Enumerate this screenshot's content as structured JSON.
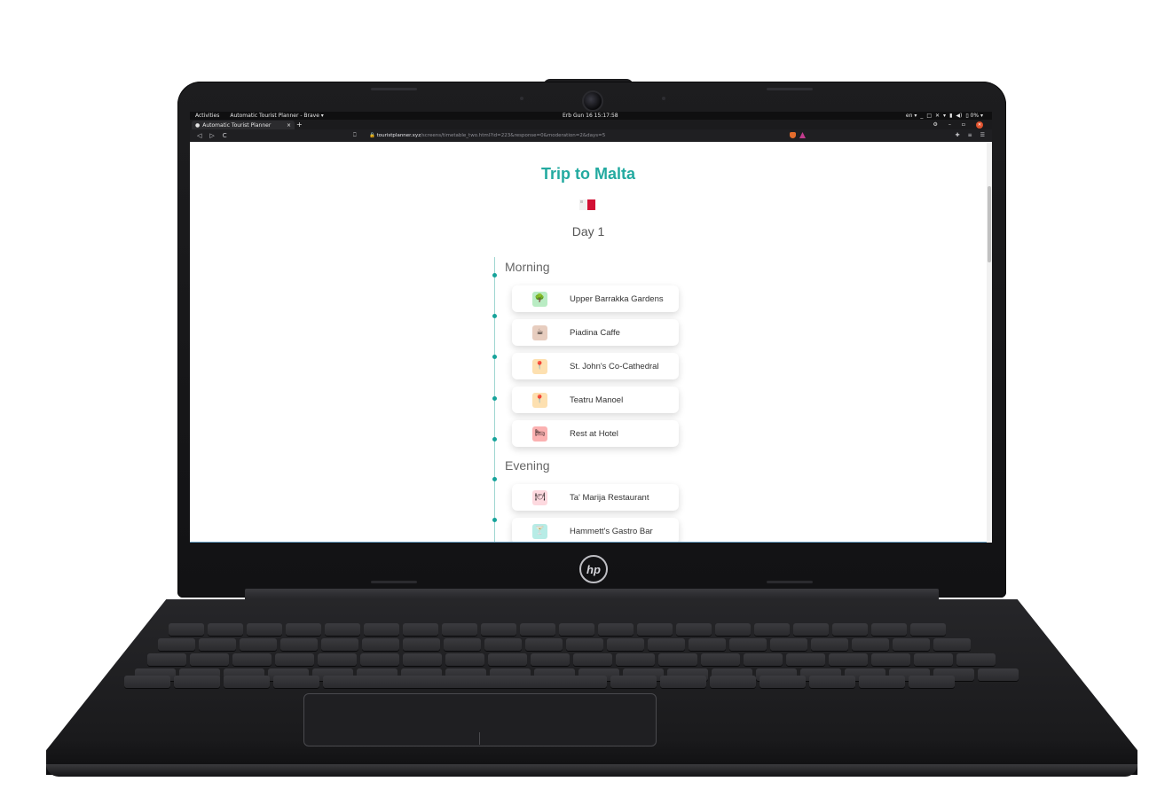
{
  "system_bar": {
    "activities": "Activities",
    "app_menu": "Automatic Tourist Planner - Brave ▾",
    "clock": "Erb Gun 16  15:17:58",
    "indicators": [
      "en ▾",
      "_",
      "□",
      "✕",
      "▾",
      "▮",
      "◀)",
      "▯ 0% ▾"
    ]
  },
  "browser": {
    "tab_title": "Automatic Tourist Planner",
    "tab_close": "×",
    "new_tab": "+",
    "window_min": "–",
    "window_max": "▫",
    "window_close": "✕",
    "url_host": "touristplanner.xyz",
    "url_path": "/screens/timetable_two.html?id=223&response=0&moderation=2&days=5",
    "nav_back": "◁",
    "nav_forward": "▷",
    "nav_reload": "C"
  },
  "page": {
    "title": "Trip to Malta",
    "day_label": "Day 1",
    "sections": [
      {
        "name": "Morning",
        "items": [
          {
            "label": "Upper Barrakka Gardens",
            "icon": "tree-icon",
            "color": "#b9ecc3",
            "glyph": "🌳"
          },
          {
            "label": "Piadina Caffe",
            "icon": "coffee-icon",
            "color": "#e7cdbf",
            "glyph": "☕"
          },
          {
            "label": "St. John's Co-Cathedral",
            "icon": "pin-icon",
            "color": "#fde0b0",
            "glyph": "📍"
          },
          {
            "label": "Teatru Manoel",
            "icon": "pin-icon",
            "color": "#fde0b0",
            "glyph": "📍"
          },
          {
            "label": "Rest at Hotel",
            "icon": "bed-icon",
            "color": "#fbb1b1",
            "glyph": "🛏"
          }
        ]
      },
      {
        "name": "Evening",
        "items": [
          {
            "label": "Ta' Marija Restaurant",
            "icon": "restaurant-icon",
            "color": "#fdd9df",
            "glyph": "🍽"
          },
          {
            "label": "Hammett's Gastro Bar",
            "icon": "cocktail-icon",
            "color": "#b7ece6",
            "glyph": "🍸"
          }
        ]
      }
    ]
  },
  "colors": {
    "accent": "#23aaa0",
    "timeline": "#16a39a"
  }
}
